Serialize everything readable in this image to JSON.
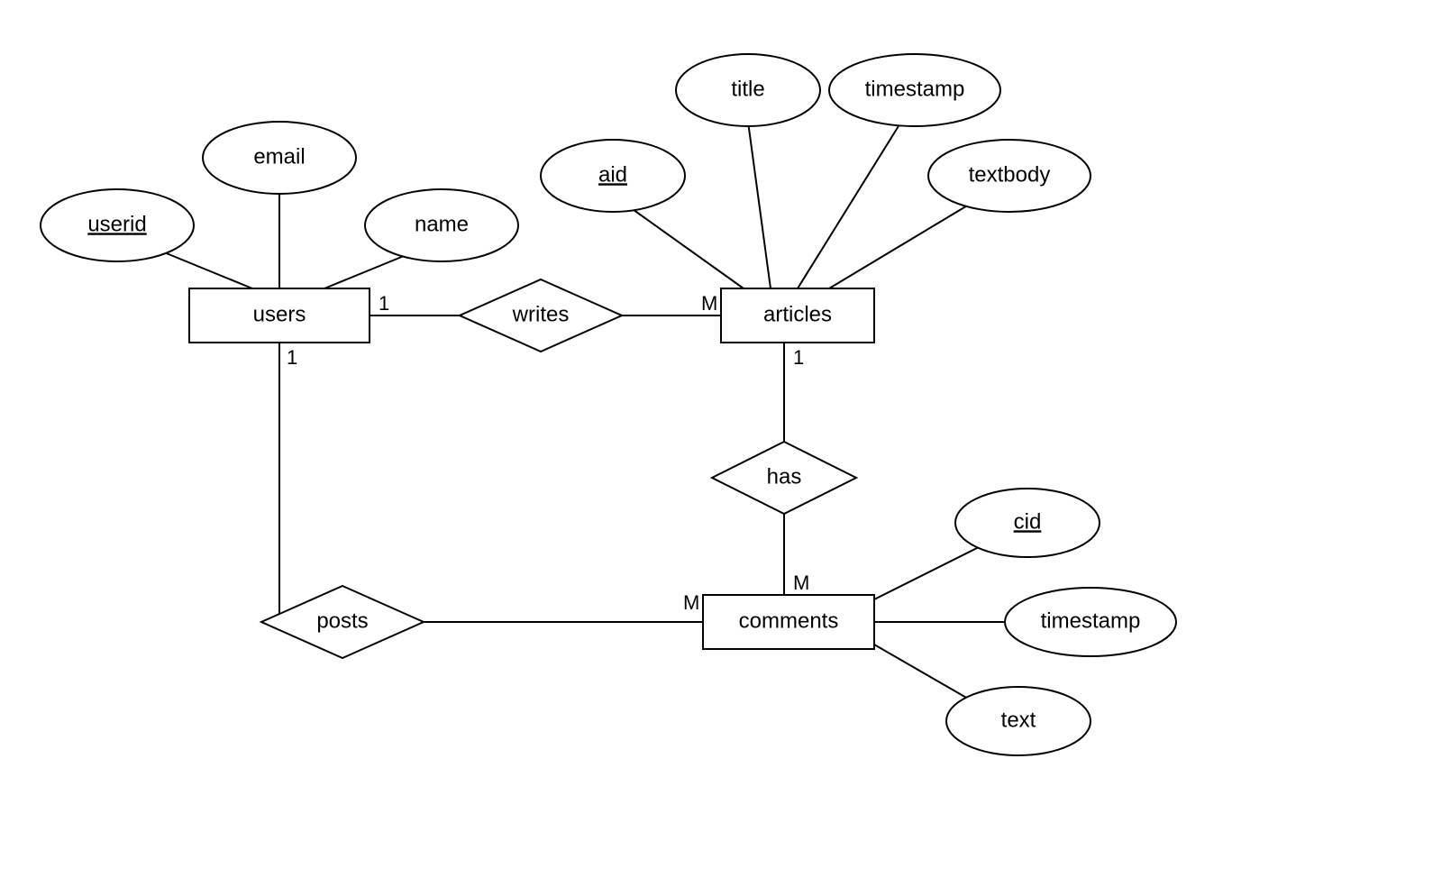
{
  "diagram": {
    "type": "ER",
    "entities": {
      "users": {
        "label": "users",
        "attributes": [
          {
            "id": "userid",
            "label": "userid",
            "pk": true
          },
          {
            "id": "email",
            "label": "email",
            "pk": false
          },
          {
            "id": "name",
            "label": "name",
            "pk": false
          }
        ]
      },
      "articles": {
        "label": "articles",
        "attributes": [
          {
            "id": "aid",
            "label": "aid",
            "pk": true
          },
          {
            "id": "title",
            "label": "title",
            "pk": false
          },
          {
            "id": "timestamp",
            "label": "timestamp",
            "pk": false
          },
          {
            "id": "textbody",
            "label": "textbody",
            "pk": false
          }
        ]
      },
      "comments": {
        "label": "comments",
        "attributes": [
          {
            "id": "cid",
            "label": "cid",
            "pk": true
          },
          {
            "id": "ctimestamp",
            "label": "timestamp",
            "pk": false
          },
          {
            "id": "text",
            "label": "text",
            "pk": false
          }
        ]
      }
    },
    "relationships": {
      "writes": {
        "label": "writes",
        "between": [
          "users",
          "articles"
        ],
        "cardinality": {
          "users": "1",
          "articles": "M"
        }
      },
      "has": {
        "label": "has",
        "between": [
          "articles",
          "comments"
        ],
        "cardinality": {
          "articles": "1",
          "comments": "M"
        }
      },
      "posts": {
        "label": "posts",
        "between": [
          "users",
          "comments"
        ],
        "cardinality": {
          "users": "1",
          "comments": "M"
        }
      }
    }
  }
}
